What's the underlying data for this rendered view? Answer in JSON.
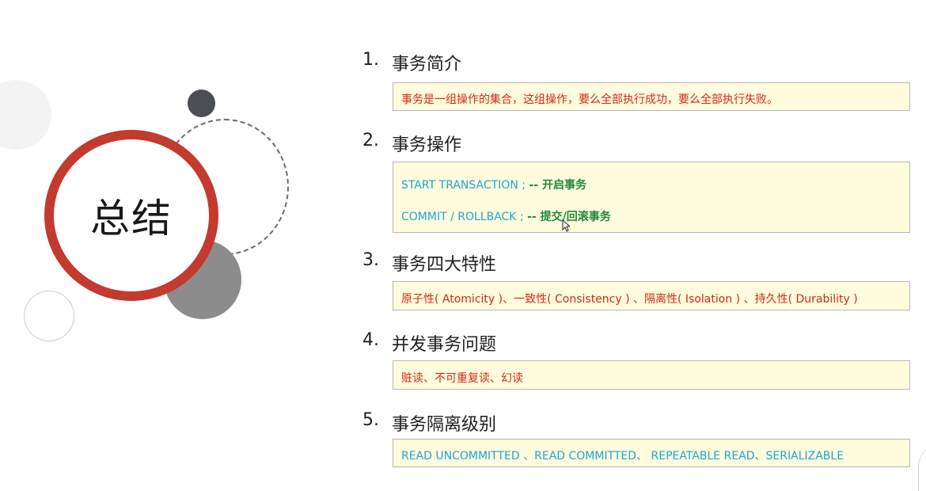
{
  "title": "总结",
  "sections": [
    {
      "num": "1.",
      "title": "事务简介",
      "text": "事务是一组操作的集合，这组操作，要么全部执行成功，要么全部执行失败。"
    },
    {
      "num": "2.",
      "title": "事务操作",
      "line1_code": "START  TRANSACTION ;",
      "line1_comment": "-- 开启事务",
      "line2_code": "COMMIT / ROLLBACK ;",
      "line2_comment": "-- 提交/回滚事务"
    },
    {
      "num": "3.",
      "title": "事务四大特性",
      "text": "原子性( Atomicity )、一致性( Consistency ) 、隔离性( Isolation ) 、持久性( Durability )"
    },
    {
      "num": "4.",
      "title": "并发事务问题",
      "text": "赃读、不可重复读、幻读"
    },
    {
      "num": "5.",
      "title": "事务隔离级别",
      "text": "READ UNCOMMITTED 、READ COMMITTED、 REPEATABLE READ、SERIALIZABLE"
    }
  ],
  "colors": {
    "accent_red": "#c33a2e",
    "text_red": "#d12a1a",
    "code_blue": "#20a6d3",
    "comment_green": "#1e8a3a",
    "box_bg": "#fffbdd"
  }
}
